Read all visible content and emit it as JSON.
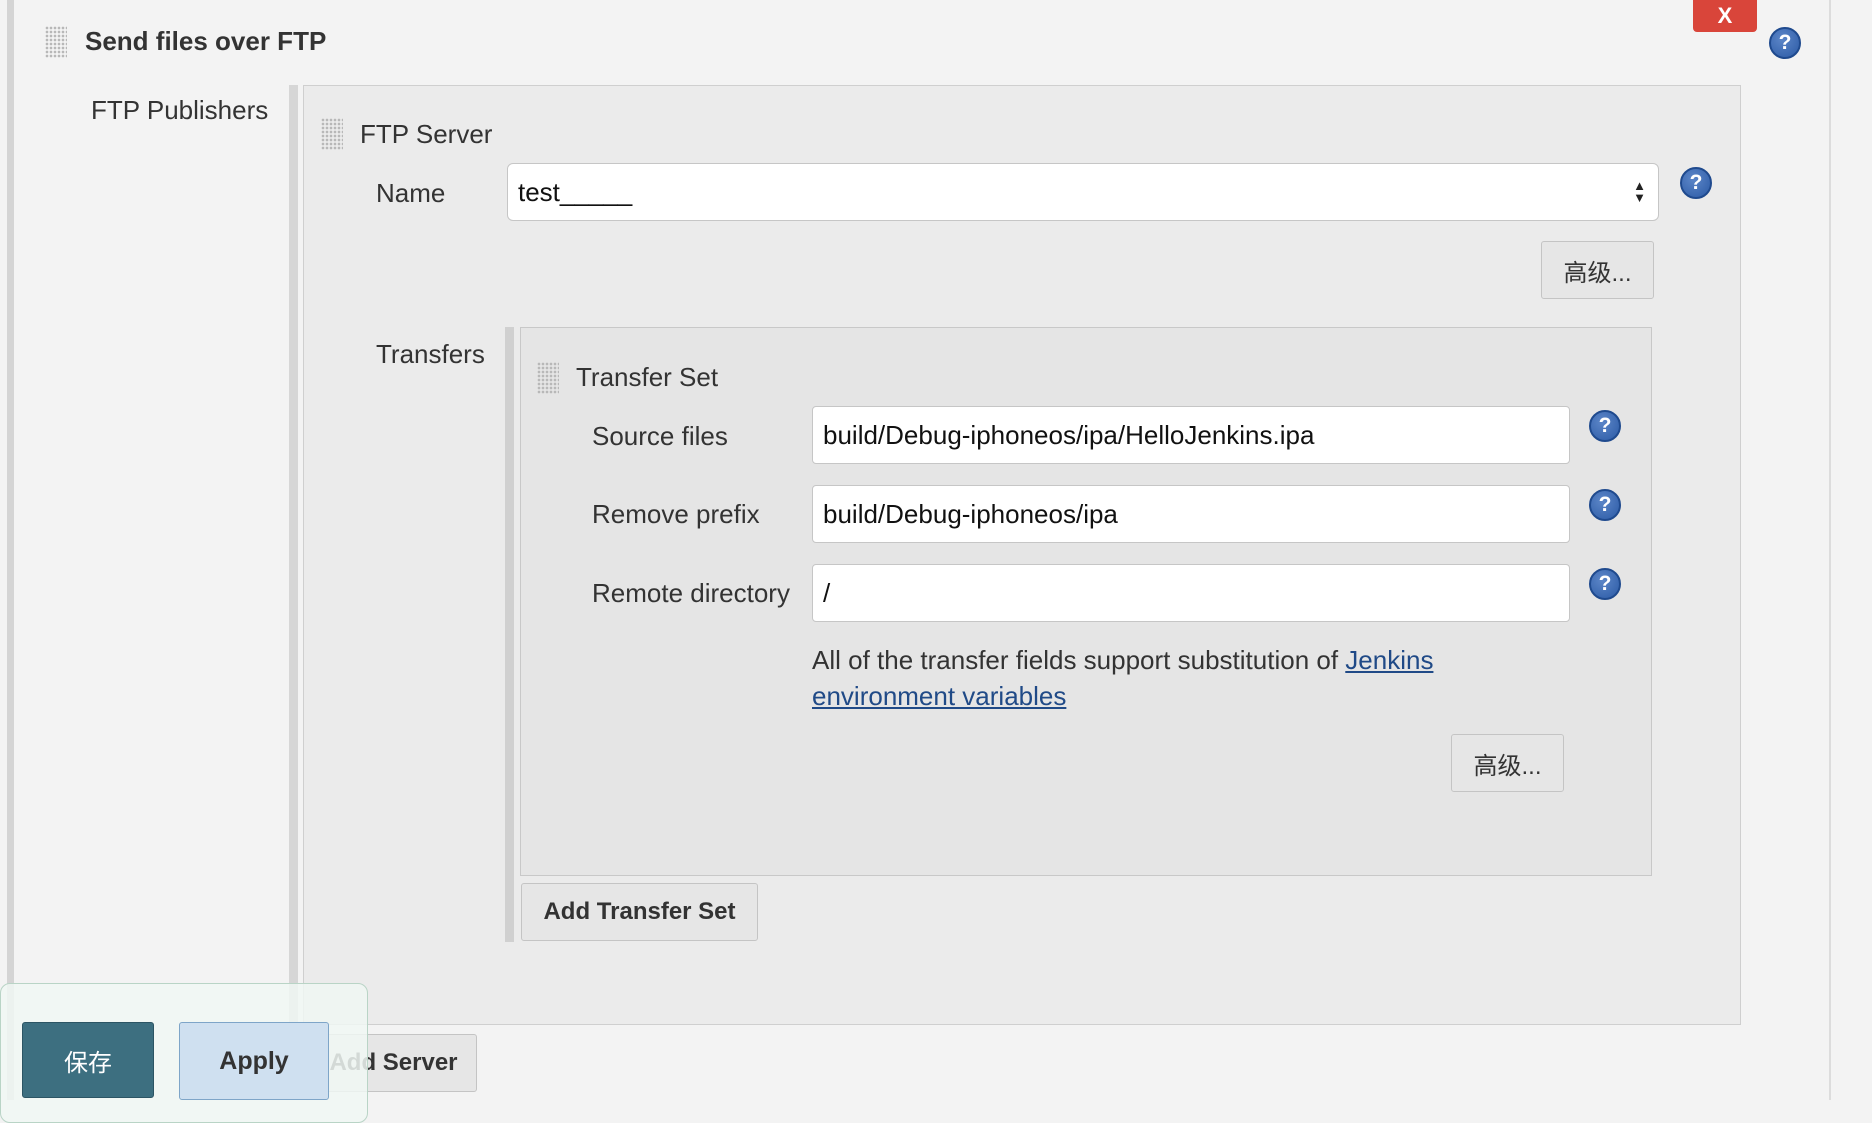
{
  "section": {
    "title": "Send files over FTP",
    "delete_label": "X",
    "help_glyph": "?"
  },
  "publishers": {
    "label": "FTP Publishers"
  },
  "server": {
    "title": "FTP Server",
    "name_label": "Name",
    "name_value": "test_____",
    "advanced_label": "高级..."
  },
  "transfers": {
    "label": "Transfers",
    "set_title": "Transfer Set",
    "fields": {
      "source_label": "Source files",
      "source_value": "build/Debug-iphoneos/ipa/HelloJenkins.ipa",
      "prefix_label": "Remove prefix",
      "prefix_value": "build/Debug-iphoneos/ipa",
      "remote_label": "Remote directory",
      "remote_value": "/"
    },
    "note_text": "All of the transfer fields support substitution of ",
    "note_link": "Jenkins environment variables",
    "advanced_label": "高级...",
    "add_set_label": "Add Transfer Set"
  },
  "add_server_label": "Add Server",
  "footer": {
    "save_label": "保存",
    "apply_label": "Apply"
  },
  "icons": {
    "help": "help-icon",
    "drag": "drag-handle-icon",
    "select": "select-arrows-icon"
  },
  "colors": {
    "delete": "#d9453a",
    "help": "#2b5aa5",
    "save": "#3d6f80",
    "apply": "#cfe0f0",
    "link": "#204a87"
  }
}
